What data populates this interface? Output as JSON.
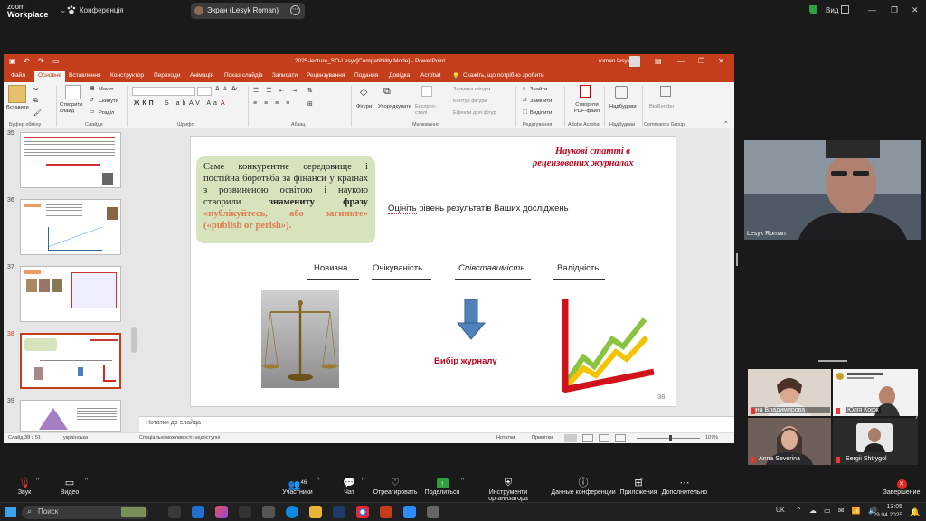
{
  "zoom": {
    "logo_line1": "zoom",
    "logo_line2": "Workplace",
    "conference_label": "Конференція",
    "screen_share_label": "Экран (Lesyk Roman)",
    "view_label": "Вид",
    "toolbar": {
      "mute": "Звук",
      "video": "Видео",
      "participants": "Участники",
      "participants_count": "46",
      "chat": "Чат",
      "react": "Отреагировать",
      "share": "Поделиться",
      "host_tools": "Инструменти организатора",
      "conference_data": "Данные конференции",
      "apps": "Приложения",
      "more": "Дополнительно",
      "end": "Завершение"
    },
    "participants": [
      {
        "name": "Lesyk Roman"
      },
      {
        "name": "Інна Владимирова"
      },
      {
        "name": "Юлія Корж"
      },
      {
        "name": "Anna Severina"
      },
      {
        "name": "Sergii Shtrygol"
      }
    ]
  },
  "ppt": {
    "window_title": "2025-lecture_SO-Lesyk[Compatibility Mode] - PowerPoint",
    "user": "roman.lesyk",
    "tabs": [
      "Файл",
      "Основне",
      "Вставлення",
      "Конструктор",
      "Переходи",
      "Анімація",
      "Показ слайдів",
      "Записати",
      "Рецензування",
      "Подання",
      "Довідка",
      "Acrobat"
    ],
    "active_tab": "Основне",
    "tell_me": "Скажіть, що потрібно зробити",
    "ribbon": {
      "paste": "Вставити",
      "clipboard": "Буфер обміну",
      "new_slide": "Створити слайд",
      "layout": "Макет",
      "reset": "Скинути",
      "section": "Розділ",
      "slides": "Слайди",
      "font": "Шрифт",
      "paragraph": "Абзац",
      "shapes": "Фігури",
      "arrange": "Упорядкувати",
      "quick_styles": "Експрес-стилі",
      "shape_fill": "Заливка фігури",
      "shape_outline": "Контур фігури",
      "shape_effects": "Ефекти для фігур",
      "drawing": "Малювання",
      "find": "Знайти",
      "replace": "Замінити",
      "select": "Виділити",
      "editing": "Редагування",
      "create_pdf": "Створити PDF-файл",
      "adobe": "Adobe Acrobat",
      "designer": "Надбудови",
      "addins": "Надбудови",
      "biorender": "BioRender",
      "commands": "Commands Group"
    },
    "thumbnail_numbers": [
      "35",
      "36",
      "37",
      "38",
      "39"
    ],
    "notes_placeholder": "Нотатки до слайда",
    "status": {
      "slide_of": "Слайд 38 з 51",
      "language": "українська",
      "accessibility": "Спеціальні можливості: недоступні",
      "notes": "Нотатки",
      "comments": "Примітки",
      "zoom": "107%"
    }
  },
  "slide": {
    "heading_right_line1": "Наукові статті в",
    "heading_right_line2": "рецензованих журналах",
    "box_text_plain": "Саме конкурентне середовище і постійна боротьба за фінанси у країнах з розвиненою освітою і наукою створили",
    "box_text_bold": "знамениту фразу",
    "box_text_quote": "«публікуйтесь, або загиньте» («publish or perish»).",
    "assess_prefix": "Оцініть",
    "assess_rest": " рівень результатів Ваших досліджень",
    "criteria": [
      "Новизна",
      "Очікуваність",
      "Співставимість",
      "Валідність"
    ],
    "journal_choice": "Вибір журналу",
    "page_number": "38"
  },
  "taskbar": {
    "search": "Поиск",
    "lang": "UK",
    "time": "13:05",
    "date": "29.04.2025"
  }
}
